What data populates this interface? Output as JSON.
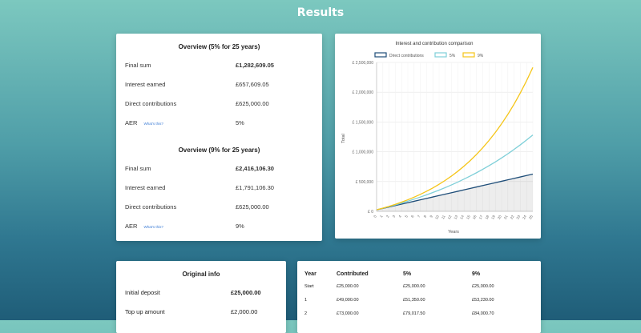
{
  "page": {
    "title": "Results"
  },
  "overview": [
    {
      "title": "Overview (5% for 25 years)",
      "rows": [
        {
          "label": "Final sum",
          "value": "£1,282,609.05",
          "bold": true
        },
        {
          "label": "Interest earned",
          "value": "£657,609.05"
        },
        {
          "label": "Direct contributions",
          "value": "£625,000.00"
        },
        {
          "label": "AER",
          "value": "5%",
          "link": "What's this?"
        }
      ]
    },
    {
      "title": "Overview (9% for 25 years)",
      "rows": [
        {
          "label": "Final sum",
          "value": "£2,416,106.30",
          "bold": true
        },
        {
          "label": "Interest earned",
          "value": "£1,791,106.30"
        },
        {
          "label": "Direct contributions",
          "value": "£625,000.00"
        },
        {
          "label": "AER",
          "value": "9%",
          "link": "What's this?"
        }
      ]
    }
  ],
  "original_info": {
    "title": "Original info",
    "rows": [
      {
        "label": "Initial deposit",
        "value": "£25,000.00",
        "bold": true
      },
      {
        "label": "Top up amount",
        "value": "£2,000.00"
      }
    ]
  },
  "table": {
    "headers": [
      "Year",
      "Contributed",
      "5%",
      "9%"
    ],
    "rows": [
      [
        "Start",
        "£25,000.00",
        "£25,000.00",
        "£25,000.00"
      ],
      [
        "1",
        "£49,000.00",
        "£51,350.00",
        "£53,230.00"
      ],
      [
        "2",
        "£73,000.00",
        "£79,017.50",
        "£84,000.70"
      ]
    ]
  },
  "chart_data": {
    "type": "line",
    "title": "Interest and contribution comparison",
    "xlabel": "Years",
    "ylabel": "Total",
    "ylim": [
      0,
      2500000
    ],
    "yticks": [
      0,
      500000,
      1000000,
      1500000,
      2000000,
      2500000
    ],
    "ytick_labels": [
      "£ 0",
      "£ 500,000",
      "£ 1,000,000",
      "£ 1,500,000",
      "£ 2,000,000",
      "£ 2,500,000"
    ],
    "x": [
      0,
      1,
      2,
      3,
      4,
      5,
      6,
      7,
      8,
      9,
      10,
      11,
      12,
      13,
      14,
      15,
      16,
      17,
      18,
      19,
      20,
      21,
      22,
      23,
      24,
      25
    ],
    "legend_position": "top",
    "series": [
      {
        "name": "Direct contributions",
        "color": "#1f4e79",
        "fill": true,
        "values": [
          25000,
          49000,
          73000,
          97000,
          121000,
          145000,
          169000,
          193000,
          217000,
          241000,
          265000,
          289000,
          313000,
          337000,
          361000,
          385000,
          409000,
          433000,
          457000,
          481000,
          505000,
          529000,
          553000,
          577000,
          601000,
          625000
        ]
      },
      {
        "name": "5%",
        "color": "#7ecfd8",
        "fill": false,
        "values": [
          25000,
          51350,
          79018,
          108069,
          138572,
          170601,
          204231,
          239542,
          276620,
          315551,
          356428,
          399350,
          444417,
          491738,
          541425,
          593596,
          648376,
          705895,
          766290,
          829704,
          896289,
          966204,
          1039614,
          1116695,
          1197629,
          1282609
        ]
      },
      {
        "name": "9%",
        "color": "#f5c518",
        "fill": false,
        "values": [
          25000,
          53230,
          84001,
          117541,
          154100,
          193949,
          237384,
          284729,
          336334,
          392584,
          453896,
          520726,
          593571,
          672972,
          759519,
          853856,
          956683,
          1068765,
          1190934,
          1324098,
          1469247,
          1627459,
          1799911,
          1987884,
          2192778,
          2416106
        ]
      }
    ]
  }
}
